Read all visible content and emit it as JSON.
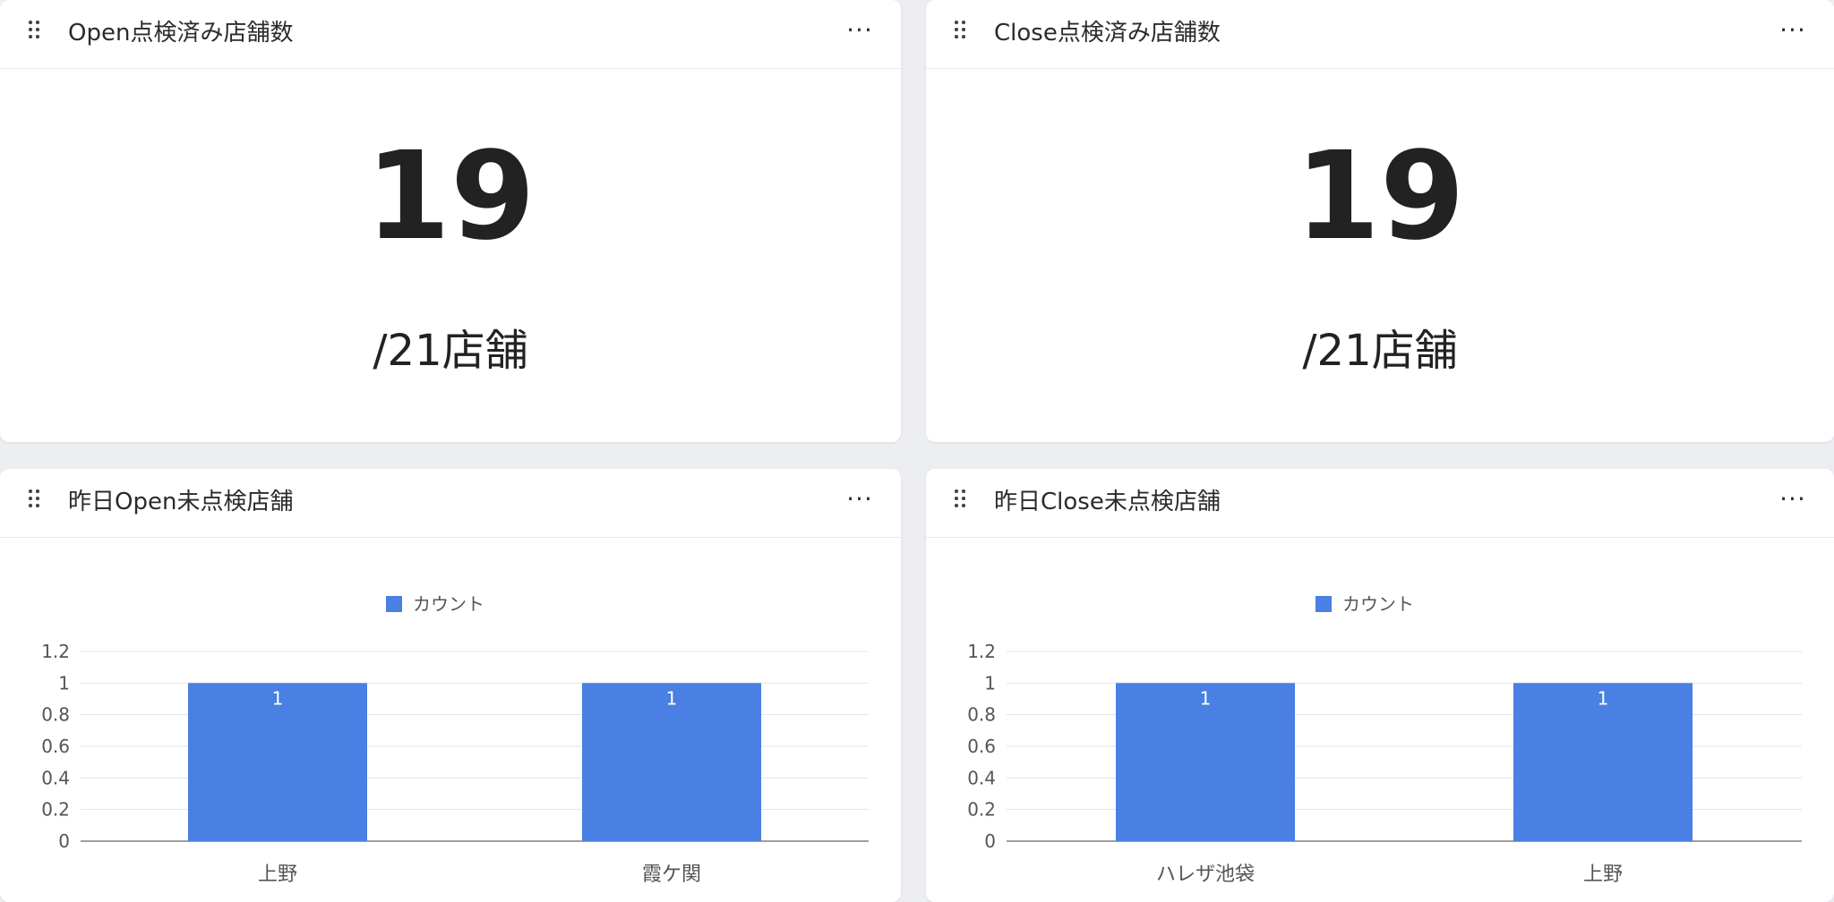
{
  "cards": {
    "open_checked": {
      "title": "Open点検済み店舗数",
      "value": "19",
      "sub": "/21店舗"
    },
    "close_checked": {
      "title": "Close点検済み店舗数",
      "value": "19",
      "sub": "/21店舗"
    },
    "open_unchecked": {
      "title": "昨日Open未点検店舗"
    },
    "close_unchecked": {
      "title": "昨日Close未点検店舗"
    }
  },
  "more_label": "···",
  "colors": {
    "bar": "#4a7fe3",
    "grid": "#e3e3e3",
    "axis": "#9e9e9e",
    "text": "#555555"
  },
  "chart_data": [
    {
      "type": "bar",
      "title": "昨日Open未点検店舗",
      "categories": [
        "上野",
        "霞ケ関"
      ],
      "series": [
        {
          "name": "カウント",
          "values": [
            1,
            1
          ]
        }
      ],
      "data_labels": [
        "1",
        "1"
      ],
      "ylim": [
        0,
        1.2
      ],
      "yticks": [
        "0",
        "0.2",
        "0.4",
        "0.6",
        "0.8",
        "1",
        "1.2"
      ],
      "grid": true,
      "legend": "top-center"
    },
    {
      "type": "bar",
      "title": "昨日Close未点検店舗",
      "categories": [
        "ハレザ池袋",
        "上野"
      ],
      "series": [
        {
          "name": "カウント",
          "values": [
            1,
            1
          ]
        }
      ],
      "data_labels": [
        "1",
        "1"
      ],
      "ylim": [
        0,
        1.2
      ],
      "yticks": [
        "0",
        "0.2",
        "0.4",
        "0.6",
        "0.8",
        "1",
        "1.2"
      ],
      "grid": true,
      "legend": "top-center"
    }
  ]
}
